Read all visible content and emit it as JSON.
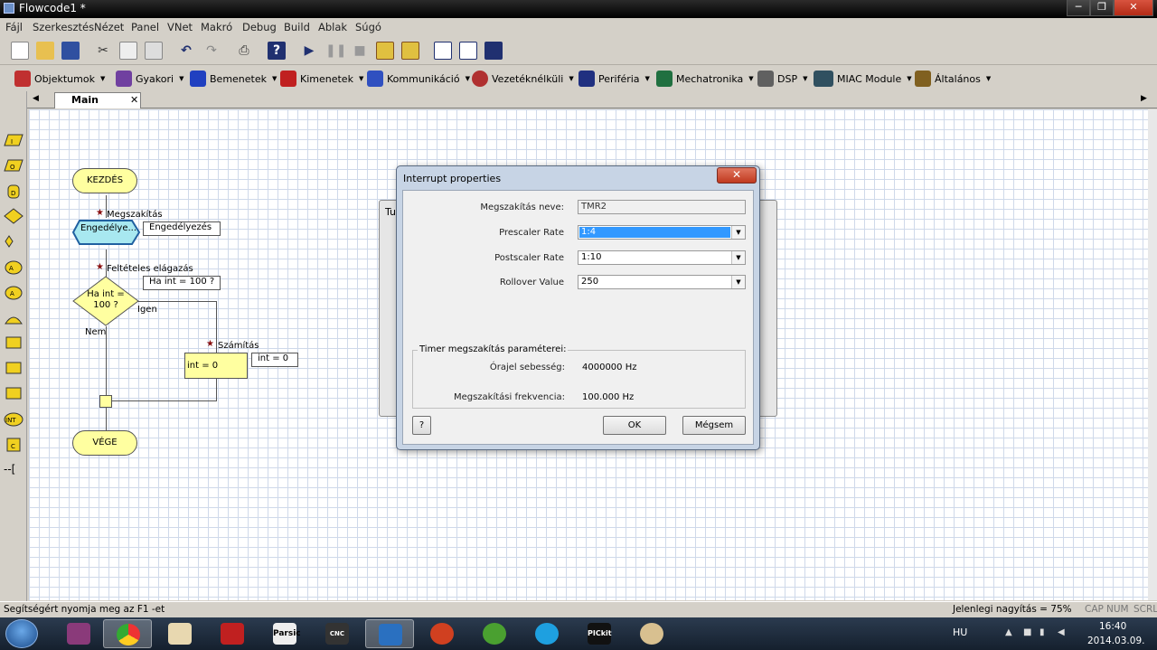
{
  "window": {
    "title": "Flowcode1 *",
    "min": "─",
    "max": "❐",
    "close": "✕"
  },
  "menu": [
    "Fájl",
    "Szerkesztés",
    "Nézet",
    "Panel",
    "VNet",
    "Makró",
    "Debug",
    "Build",
    "Ablak",
    "Súgó"
  ],
  "component_toolbar": [
    "Objektumok",
    "Gyakori",
    "Bemenetek",
    "Kimenetek",
    "Kommunikáció",
    "Vezetéknélküli",
    "Periféria",
    "Mechatronika",
    "DSP",
    "MIAC Module",
    "Általános"
  ],
  "tabs": {
    "main": "Main",
    "close": "✕",
    "left_arrow": "◀",
    "right_arrow": "▶"
  },
  "flowchart": {
    "start": "KEZDÉS",
    "end": "VÉGE",
    "interrupt_title": "Megszakítás",
    "interrupt_shape": "Engedélye...",
    "interrupt_callout": "Engedélyezés",
    "decision_title": "Feltételes elágazás",
    "decision_shape": "Ha int =\n100 ?",
    "decision_callout": "Ha int = 100 ?",
    "yes": "Igen",
    "no": "Nem",
    "calc_title": "Számítás",
    "calc_shape": "int = 0",
    "calc_callout": "int = 0",
    "star": "★"
  },
  "bg_dialog_title": "Tu",
  "dialog": {
    "title": "Interrupt properties",
    "close": "✕",
    "name_label": "Megszakítás neve:",
    "name_value": "TMR2",
    "prescaler_label": "Prescaler Rate",
    "prescaler_value": "1:4",
    "postscaler_label": "Postscaler Rate",
    "postscaler_value": "1:10",
    "rollover_label": "Rollover Value",
    "rollover_value": "250",
    "group_title": "Timer megszakítás paraméterei:",
    "clock_label": "Órajel sebesség:",
    "clock_value": "4000000 Hz",
    "freq_label": "Megszakítási frekvencia:",
    "freq_value": "100.000 Hz",
    "help": "?",
    "ok": "OK",
    "cancel": "Mégsem",
    "dropdown_arrow": "▼"
  },
  "status": {
    "help": "Segítségért nyomja meg az F1 -et",
    "zoom": "Jelenlegi nagyítás = 75%",
    "cap": "CAP",
    "num": "NUM",
    "scrl": "SCRL"
  },
  "taskbar": {
    "apps": [
      "Parsic",
      "CNC USB",
      "PICkit 2"
    ],
    "lang": "HU",
    "time": "16:40",
    "date": "2014.03.09."
  },
  "colors": {
    "flow_fill": "#ffffa0",
    "interrupt_fill": "#a8e8f0",
    "selection": "#3399ff"
  }
}
